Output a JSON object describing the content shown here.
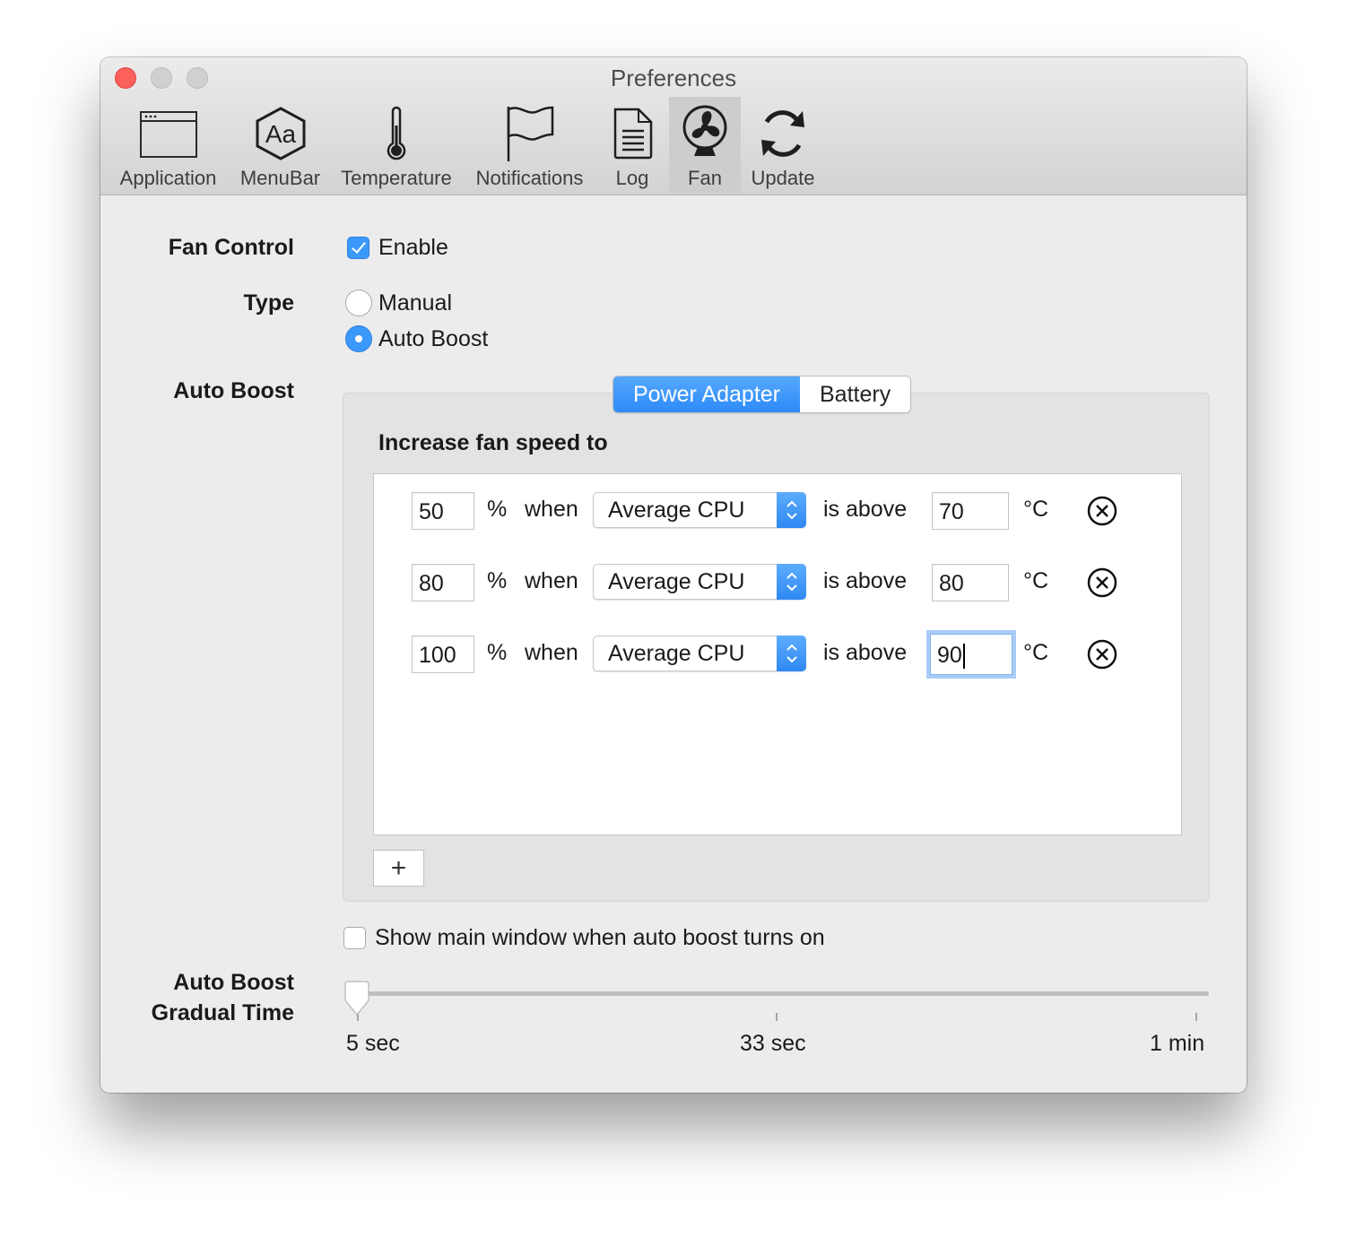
{
  "window": {
    "title": "Preferences"
  },
  "toolbar": {
    "items": [
      {
        "label": "Application",
        "icon": "application-window-icon"
      },
      {
        "label": "MenuBar",
        "icon": "aa-font-icon"
      },
      {
        "label": "Temperature",
        "icon": "thermometer-icon"
      },
      {
        "label": "Notifications",
        "icon": "flag-icon"
      },
      {
        "label": "Log",
        "icon": "document-icon"
      },
      {
        "label": "Fan",
        "icon": "fan-icon",
        "selected": true
      },
      {
        "label": "Update",
        "icon": "refresh-icon"
      }
    ]
  },
  "fan_control": {
    "label": "Fan Control",
    "enable_label": "Enable",
    "enabled": true
  },
  "type": {
    "label": "Type",
    "options": [
      {
        "label": "Manual",
        "selected": false
      },
      {
        "label": "Auto Boost",
        "selected": true
      }
    ]
  },
  "auto_boost": {
    "label": "Auto Boost",
    "tabs": [
      {
        "label": "Power Adapter",
        "active": true
      },
      {
        "label": "Battery",
        "active": false
      }
    ],
    "section_title": "Increase fan speed to",
    "rules": [
      {
        "percent": "50",
        "percent_unit": "%",
        "when": "when",
        "sensor": "Average CPU",
        "is_above": "is above",
        "temp": "70",
        "temp_unit": "°C"
      },
      {
        "percent": "80",
        "percent_unit": "%",
        "when": "when",
        "sensor": "Average CPU",
        "is_above": "is above",
        "temp": "80",
        "temp_unit": "°C"
      },
      {
        "percent": "100",
        "percent_unit": "%",
        "when": "when",
        "sensor": "Average CPU",
        "is_above": "is above",
        "temp": "90",
        "temp_unit": "°C",
        "focused": true
      }
    ],
    "add_button": "+"
  },
  "show_main_window": {
    "label": "Show main window when auto boost turns on",
    "checked": false
  },
  "gradual_time": {
    "label_line1": "Auto Boost",
    "label_line2": "Gradual Time",
    "value_fraction": 0.0,
    "tick_labels": [
      "5 sec",
      "33 sec",
      "1 min"
    ]
  },
  "colors": {
    "accent": "#3b99fc",
    "close": "#fc605b"
  }
}
